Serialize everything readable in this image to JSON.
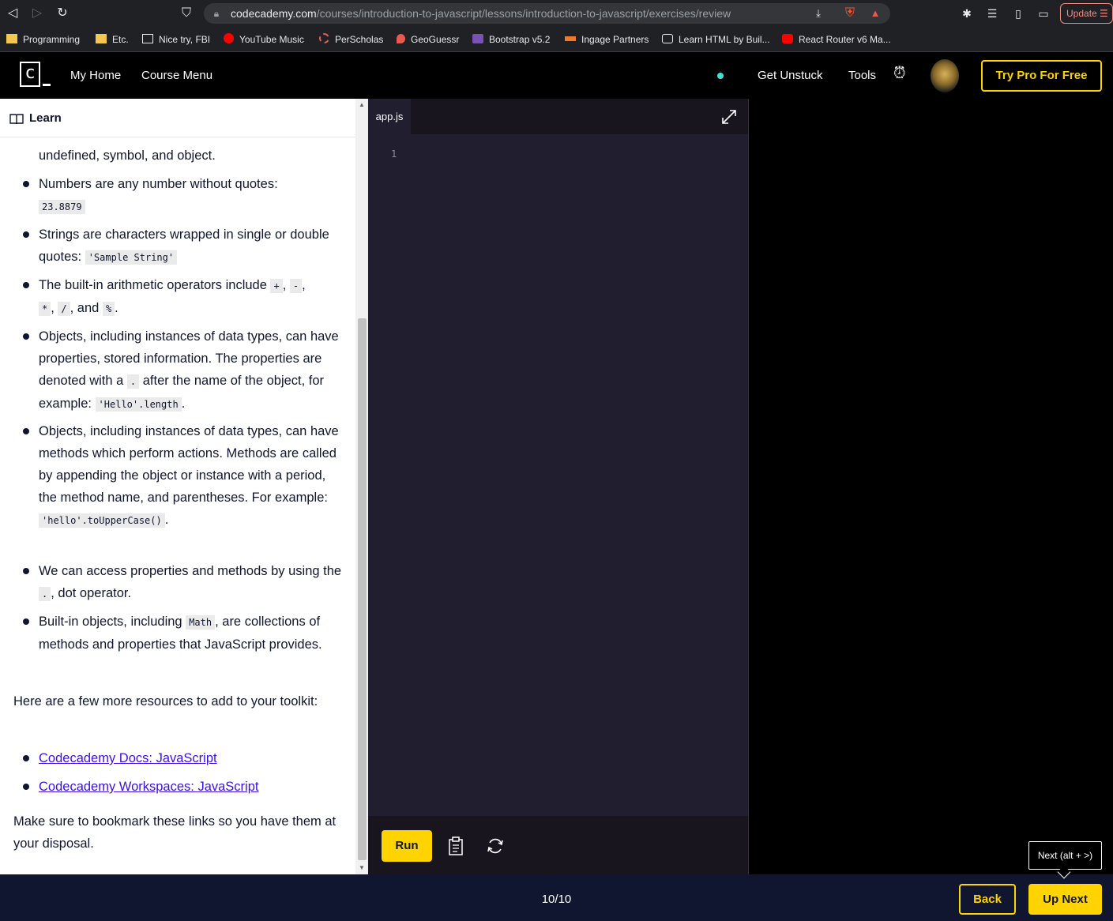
{
  "browser": {
    "url_domain": "codecademy.com",
    "url_path": "/courses/introduction-to-javascript/lessons/introduction-to-javascript/exercises/review",
    "update_label": "Update"
  },
  "bookmarks": [
    "Programming",
    "Etc.",
    "Nice try, FBI",
    "YouTube Music",
    "PerScholas",
    "GeoGuessr",
    "Bootstrap v5.2",
    "Ingage Partners",
    "Learn HTML by Buil...",
    "React Router v6 Ma..."
  ],
  "header": {
    "logo_letter": "c",
    "nav": [
      "My Home",
      "Course Menu"
    ],
    "get_unstuck": "Get Unstuck",
    "tools": "Tools",
    "pro_button": "Try Pro For Free"
  },
  "learn": {
    "title": "Learn",
    "partial_top": "undefined, symbol, and object.",
    "bullets": [
      {
        "pre": "Numbers are any number without quotes: ",
        "code": "23.8879",
        "post": ""
      },
      {
        "pre": "Strings are characters wrapped in single or double quotes: ",
        "code": "'Sample String'",
        "post": ""
      },
      {
        "pre": "The built-in arithmetic operators include ",
        "codes": [
          "+",
          "-",
          "*",
          "/",
          "%"
        ],
        "post": "."
      },
      {
        "pre": "Objects, including instances of data types, can have properties, stored information. The properties are denoted with a ",
        "code": ".",
        "mid": " after the name of the object, for example: ",
        "code2": "'Hello'.length",
        "post": "."
      },
      {
        "pre": "Objects, including instances of data types, can have methods which perform actions. Methods are called by appending the object or instance with a period, the method name, and parentheses. For example: ",
        "code": "'hello'.toUpperCase()",
        "post": "."
      },
      {
        "pre": "We can access properties and methods by using the ",
        "code": ".",
        "post": ", dot operator."
      },
      {
        "pre": "Built-in objects, including ",
        "code": "Math",
        "post": ", are collections of methods and properties that JavaScript provides."
      }
    ],
    "resources_intro": "Here are a few more resources to add to your toolkit:",
    "links": [
      "Codecademy Docs: JavaScript",
      "Codecademy Workspaces: JavaScript"
    ],
    "closing": "Make sure to bookmark these links so you have them at your disposal."
  },
  "editor": {
    "tab": "app.js",
    "line_number": "1",
    "run_label": "Run"
  },
  "footer": {
    "progress": "10/10",
    "back_label": "Back",
    "next_label": "Up Next",
    "tooltip": "Next (alt + >)"
  }
}
